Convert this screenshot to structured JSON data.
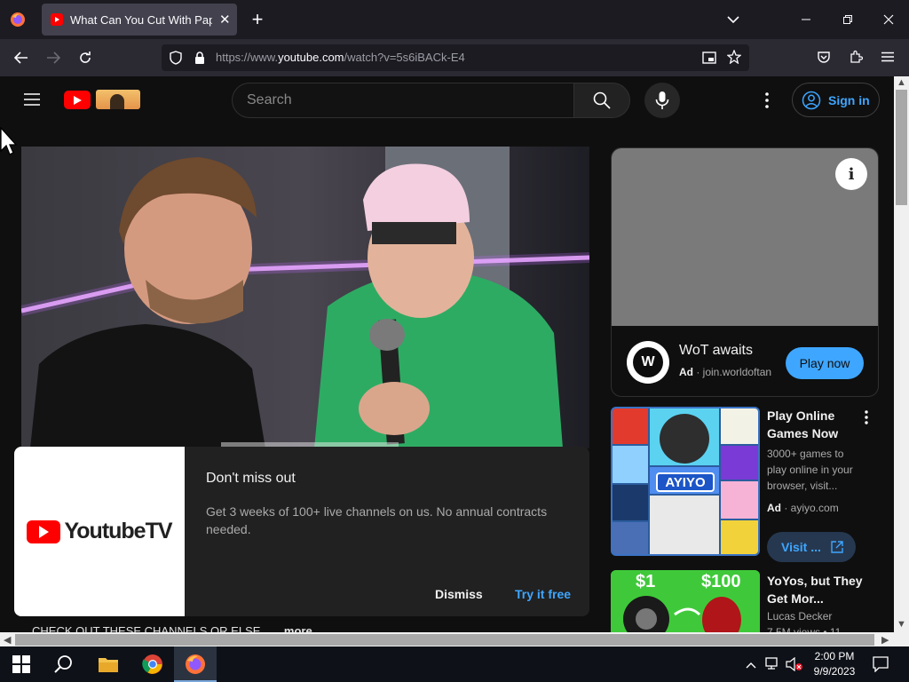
{
  "browser": {
    "tab_title": "What Can You Cut With Paper?",
    "url_prefix": "https://www.",
    "url_domain": "youtube.com",
    "url_path": "/watch?v=5s6iBACk-E4"
  },
  "youtube": {
    "search_placeholder": "Search",
    "sign_in": "Sign in"
  },
  "popup": {
    "brand": "YoutubeTV",
    "title": "Don't miss out",
    "body": "Get 3 weeks of 100+ live channels on us. No annual contracts needed.",
    "dismiss": "Dismiss",
    "try_free": "Try it free"
  },
  "description": {
    "text": "CHECK OUT THESE CHANNELS OR ELSE",
    "more": "...more"
  },
  "ad": {
    "logo_text": "W",
    "title": "WoT awaits",
    "ad_label": "Ad",
    "domain": "join.worldoftan",
    "cta": "Play now"
  },
  "recommendations": [
    {
      "title": "Play Online Games Now",
      "description": "3000+ games to play online in your browser, visit...",
      "ad_label": "Ad",
      "domain": "ayiyo.com",
      "cta": "Visit ...",
      "thumb_text": "AYIYO"
    },
    {
      "title": "YoYos, but They Get Mor...",
      "channel": "Lucas Decker",
      "meta": "7.5M views • 11...",
      "thumb_left": "$1",
      "thumb_right": "$100"
    }
  ],
  "taskbar": {
    "time": "2:00 PM",
    "date": "9/9/2023"
  }
}
